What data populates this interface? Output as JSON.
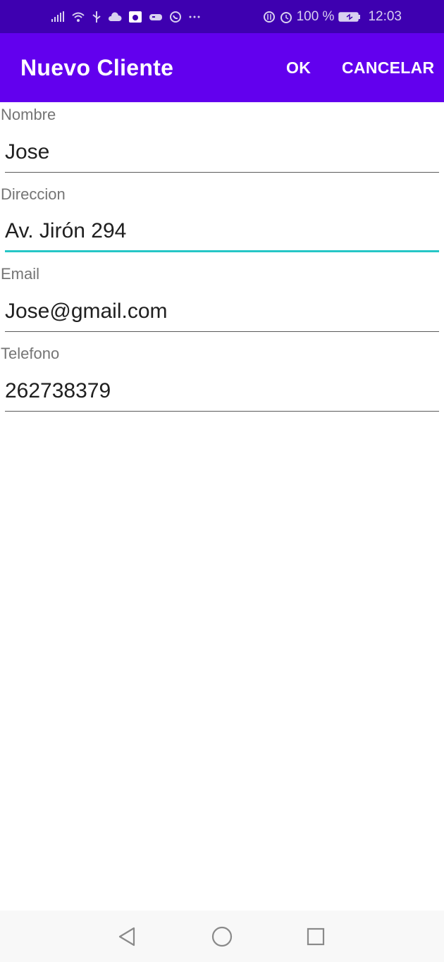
{
  "status_bar": {
    "left_icons": [
      "signal-icon",
      "wifi-icon",
      "usb-icon",
      "cloud-icon",
      "camera-icon",
      "gamepad-icon",
      "whatsapp-icon",
      "more-notifications-icon"
    ],
    "battery_text": "100 %",
    "time": "12:03",
    "right_icons": [
      "data-saver-icon",
      "alarm-icon",
      "battery-icon"
    ]
  },
  "app_bar": {
    "title": "Nuevo Cliente",
    "ok_label": "OK",
    "cancel_label": "CANCELAR",
    "color": "#6200ee"
  },
  "form": {
    "fields": [
      {
        "label": "Nombre",
        "value": "Jose"
      },
      {
        "label": "Direccion",
        "value": "Av. Jirón 294",
        "focused": true
      },
      {
        "label": "Email",
        "value": "Jose@gmail.com"
      },
      {
        "label": "Telefono",
        "value": "262738379"
      }
    ],
    "accent_color": "#26c6c6"
  },
  "nav_bar": {
    "buttons": [
      "back-icon",
      "home-icon",
      "recents-icon"
    ]
  }
}
